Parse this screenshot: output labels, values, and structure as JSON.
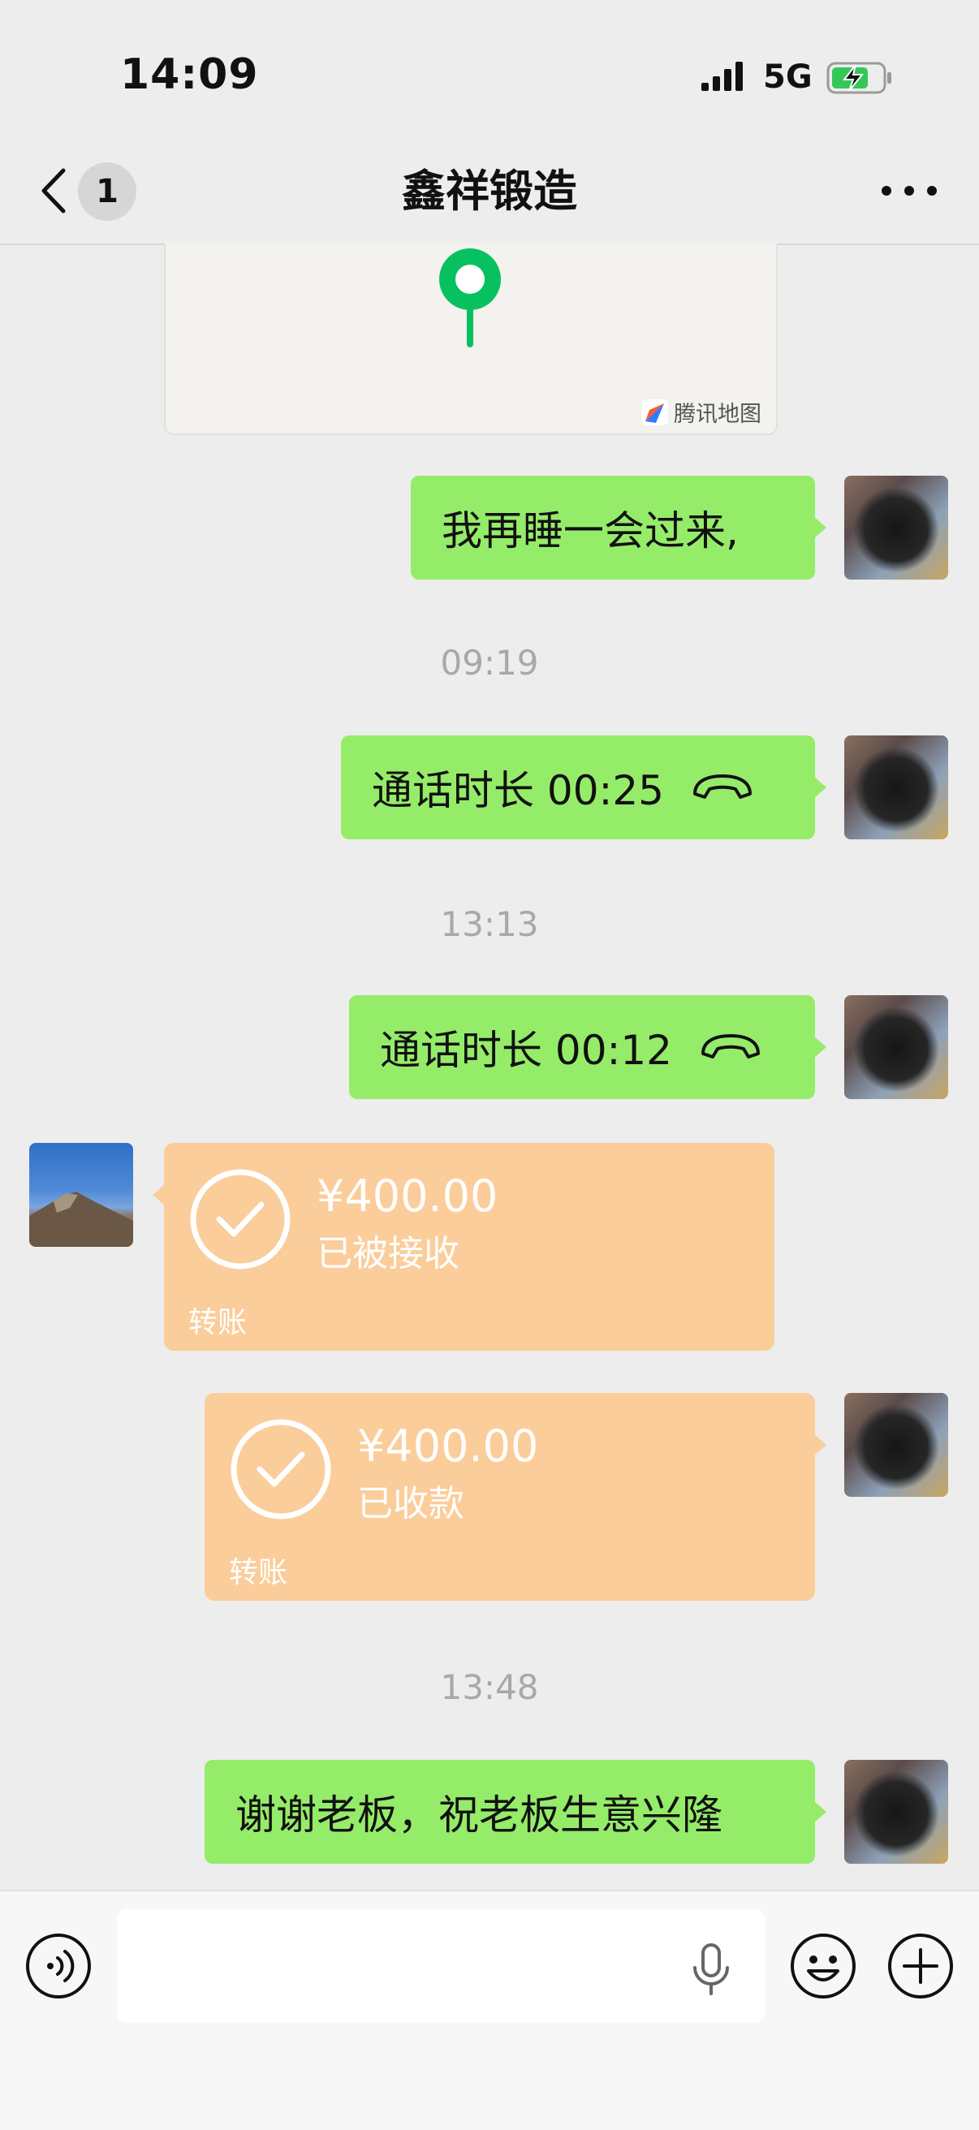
{
  "status_bar": {
    "time": "14:09",
    "network": "5G"
  },
  "header": {
    "unread_count": "1",
    "title": "鑫祥锻造"
  },
  "map": {
    "attribution": "腾讯地图"
  },
  "messages": {
    "m1_text": "我再睡一会过来,",
    "ts1": "09:19",
    "call1_text": "通话时长 00:25",
    "ts2": "13:13",
    "call2_text": "通话时长 00:12",
    "transfer_in": {
      "amount": "¥400.00",
      "status": "已被接收",
      "label": "转账"
    },
    "transfer_out": {
      "amount": "¥400.00",
      "status": "已收款",
      "label": "转账"
    },
    "ts3": "13:48",
    "m_last_text": "谢谢老板，祝老板生意兴隆"
  },
  "input": {
    "placeholder": ""
  },
  "colors": {
    "bubble_green": "#95ec69",
    "transfer_orange": "#fbcd9a",
    "map_pin_green": "#07c160"
  }
}
